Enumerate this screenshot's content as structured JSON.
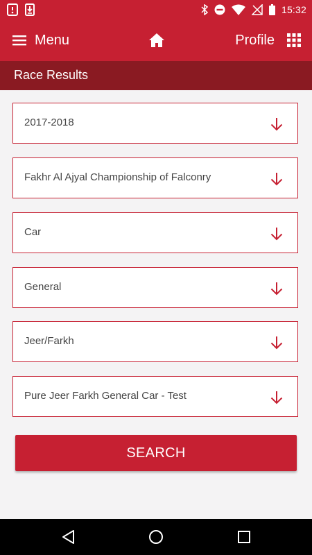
{
  "status_bar": {
    "time": "15:32",
    "icons": [
      "notification-icon",
      "download-icon",
      "bluetooth-icon",
      "do-not-disturb-icon",
      "wifi-icon",
      "no-signal-icon",
      "battery-icon"
    ]
  },
  "app_bar": {
    "menu_label": "Menu",
    "profile_label": "Profile",
    "icons": [
      "hamburger-icon",
      "home-icon",
      "grid-icon"
    ]
  },
  "section": {
    "title": "Race Results"
  },
  "filters": [
    {
      "value": "2017-2018"
    },
    {
      "value": "Fakhr Al Ajyal Championship of Falconry"
    },
    {
      "value": "Car"
    },
    {
      "value": "General"
    },
    {
      "value": "Jeer/Farkh"
    },
    {
      "value": "Pure Jeer Farkh General Car - Test"
    }
  ],
  "search": {
    "label": "SEARCH"
  },
  "nav_bar": {
    "icons": [
      "back-icon",
      "home-circle-icon",
      "recents-icon"
    ]
  },
  "colors": {
    "primary": "#c62032",
    "header_dark": "#8a1a22",
    "background": "#f4f3f4",
    "text": "#444444"
  }
}
